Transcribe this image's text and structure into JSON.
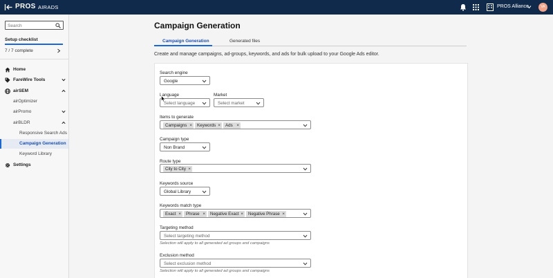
{
  "header": {
    "logo_text": "PROS",
    "app_name": "AIRADS",
    "org_name": "PROS Alliance",
    "avatar_initials": "VA",
    "back_icon": "back-arrow-icon",
    "notification_icon": "bell-icon",
    "apps_icon": "grid-icon",
    "org_icon": "building-icon"
  },
  "sidebar": {
    "search_placeholder": "Search",
    "checklist": {
      "title": "Setup checklist",
      "count": "7 / 7 complete",
      "progress": 1.0
    },
    "items": [
      {
        "label": "Home",
        "icon": "home-icon"
      },
      {
        "label": "FareWire Tools",
        "icon": "tag-icon"
      },
      {
        "label": "airSEM",
        "icon": "globe-icon"
      },
      {
        "label": "airOptimizer"
      },
      {
        "label": "airPromo"
      },
      {
        "label": "airBLDR"
      },
      {
        "label": "Responsive Search Ads"
      },
      {
        "label": "Campaign Generation"
      },
      {
        "label": "Keyword Library"
      },
      {
        "label": "Settings",
        "icon": "gear-icon"
      }
    ]
  },
  "main": {
    "title": "Campaign Generation",
    "tabs": [
      {
        "label": "Campaign Generation"
      },
      {
        "label": "Generated files"
      }
    ],
    "intro": "Create and manage campaigns, ad-groups, keywords, and ads for bulk upload to your Google Ads editor."
  },
  "form": {
    "search_engine": {
      "label": "Search engine",
      "value": "Google"
    },
    "language": {
      "label": "Language",
      "placeholder": "Select language"
    },
    "market": {
      "label": "Market",
      "placeholder": "Select market"
    },
    "items_to_generate": {
      "label": "Items to generate",
      "chips": [
        "Campaigns",
        "Keywords",
        "Ads"
      ]
    },
    "campaign_type": {
      "label": "Campaign type",
      "value": "Non Brand"
    },
    "route_type": {
      "label": "Route type",
      "chips": [
        "City to City"
      ]
    },
    "keywords_source": {
      "label": "Keywords source",
      "value": "Global Library"
    },
    "keywords_match_type": {
      "label": "Keywords match type",
      "chips": [
        "Exact",
        "Phrase",
        "Negative Exact",
        "Negative Phrase"
      ]
    },
    "targeting_method": {
      "label": "Targeting method",
      "placeholder": "Select targeting method",
      "hint": "Selection will apply to all generated ad groups and campaigns"
    },
    "exclusion_method": {
      "label": "Exclusion method",
      "placeholder": "Select exclusion method",
      "hint": "Selection will apply to all generated ad groups and campaigns"
    }
  },
  "colors": {
    "header_bg": "#0f2a4a",
    "accent": "#1a66d9",
    "active_text": "#1a4fb4",
    "chip_bg": "#dcdcdc"
  }
}
